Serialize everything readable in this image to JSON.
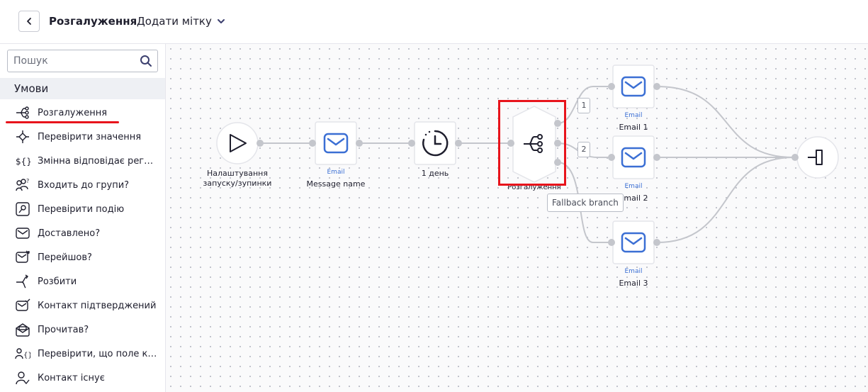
{
  "header": {
    "title": "Розгалуження",
    "add_tag": "Додати мітку"
  },
  "sidebar": {
    "search_placeholder": "Пошук",
    "section_title": "Умови",
    "items": [
      {
        "label": "Розгалуження",
        "icon": "branch-icon"
      },
      {
        "label": "Перевірити значення",
        "icon": "check-value-icon"
      },
      {
        "label": "Змінна відповідає регу...",
        "icon": "variable-icon"
      },
      {
        "label": "Входить до групи?",
        "icon": "group-icon"
      },
      {
        "label": "Перевірити подію",
        "icon": "event-icon"
      },
      {
        "label": "Доставлено?",
        "icon": "mail-icon"
      },
      {
        "label": "Перейшов?",
        "icon": "mail-click-icon"
      },
      {
        "label": "Розбити",
        "icon": "split-icon"
      },
      {
        "label": "Контакт підтверджений",
        "icon": "mail-check-icon"
      },
      {
        "label": "Прочитав?",
        "icon": "mail-open-icon"
      },
      {
        "label": "Перевірити, що поле ко...",
        "icon": "field-check-icon"
      },
      {
        "label": "Контакт існує",
        "icon": "contact-exists-icon"
      }
    ]
  },
  "flow": {
    "start": {
      "label_line1": "Налаштування",
      "label_line2": "запуску/зупинки"
    },
    "email_main": {
      "type": "Email",
      "label": "Message name"
    },
    "delay": {
      "label": "1 день"
    },
    "branch": {
      "label": "Розгалуження"
    },
    "branch_badges": [
      "1",
      "2"
    ],
    "fallback_tooltip": "Fallback branch",
    "email1": {
      "type": "Email",
      "label": "Email 1"
    },
    "email2": {
      "type": "Email",
      "label": "Email 2"
    },
    "email3": {
      "type": "Email",
      "label": "Email 3"
    }
  },
  "colors": {
    "accent_blue": "#3b6fd4",
    "highlight_red": "#e8141c",
    "connector": "#c4c6cc"
  }
}
